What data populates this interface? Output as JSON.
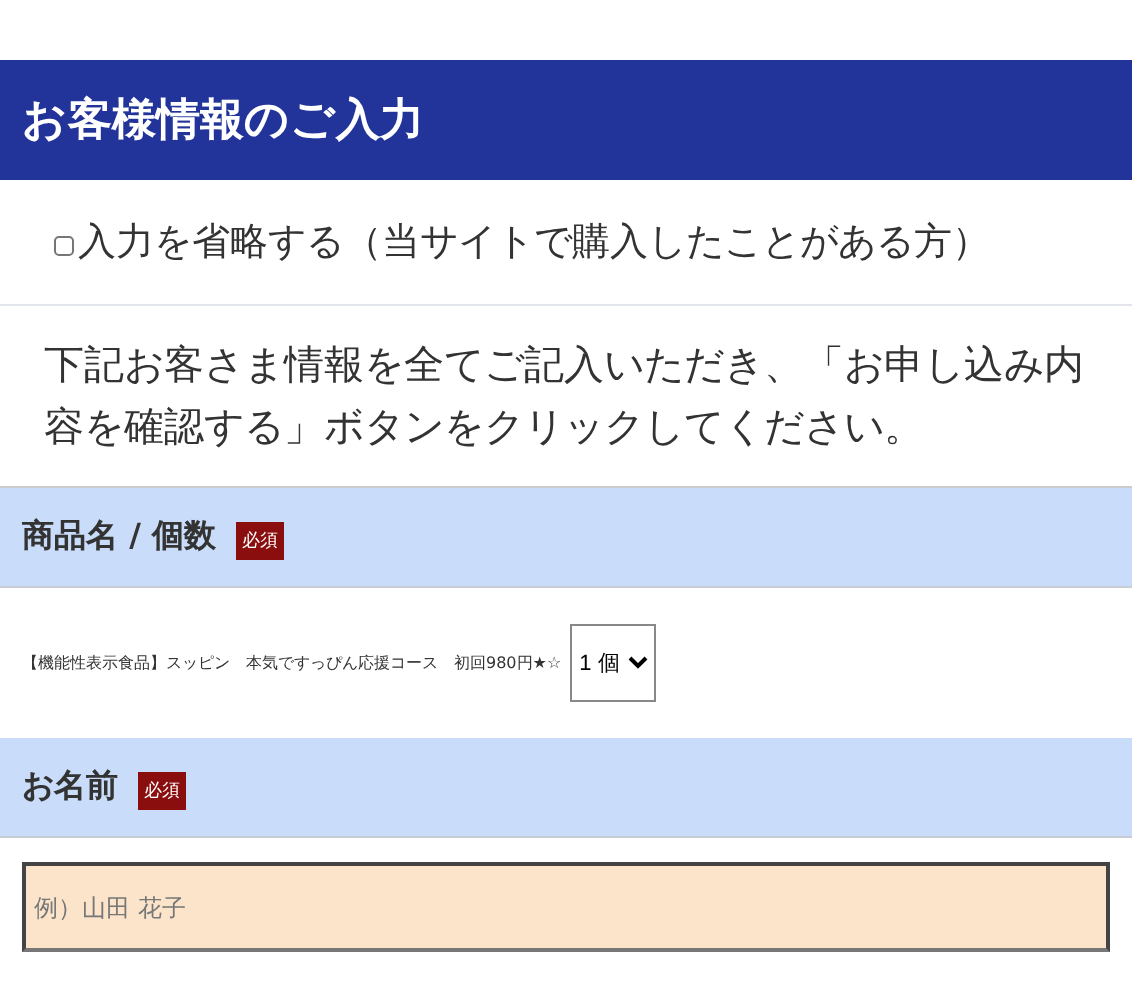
{
  "header": {
    "title": "お客様情報のご入力"
  },
  "skip_option": {
    "label": "入力を省略する（当サイトで購入したことがある方）",
    "checked": false
  },
  "instruction": "下記お客さま情報を全てご記入いただき、「お申し込み内容を確認する」ボタンをクリックしてください。",
  "sections": [
    {
      "kind": "product",
      "heading": "商品名 / 個数",
      "badge": "必須",
      "product": "【機能性表示食品】スッピン　本気ですっぴん応援コース　初回980円★☆",
      "quantity": "1 個"
    },
    {
      "kind": "text",
      "heading": "お名前",
      "badge": "必須",
      "placeholder": "例）山田 花子"
    }
  ]
}
